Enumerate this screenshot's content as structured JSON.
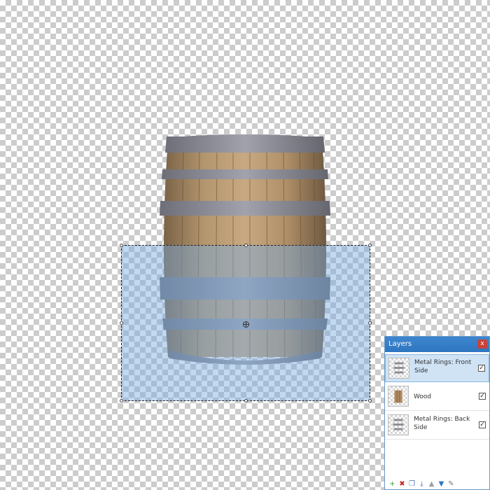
{
  "layers_panel": {
    "title": "Layers",
    "close_label": "x",
    "items": [
      {
        "name": "Metal Rings: Front Side",
        "visible": true,
        "selected": true
      },
      {
        "name": "Wood",
        "visible": true,
        "selected": false
      },
      {
        "name": "Metal Rings: Back Side",
        "visible": true,
        "selected": false
      }
    ],
    "toolbar_icons": [
      "add-layer-icon",
      "delete-layer-icon",
      "duplicate-layer-icon",
      "merge-layer-down-icon",
      "move-layer-up-icon",
      "move-layer-down-icon",
      "layer-properties-icon"
    ]
  },
  "colors": {
    "panel_title": "#2f76c0",
    "selection_fill": "#78aae1",
    "ring": "#8d8d96",
    "wood": "#b08a5e"
  }
}
